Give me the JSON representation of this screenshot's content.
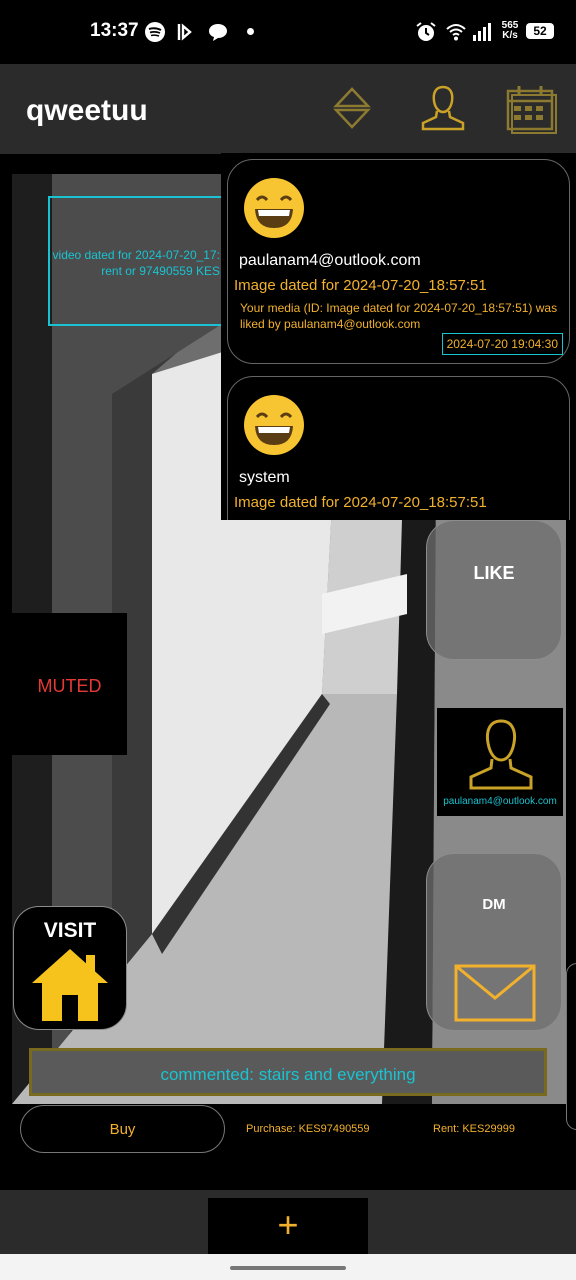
{
  "status_bar": {
    "time": "13:37",
    "network_speed_value": "565",
    "network_speed_unit": "K/s",
    "battery": "52",
    "icons": [
      "spotify-icon",
      "beeper-icon",
      "chat-icon",
      "dot-icon",
      "alarm-icon",
      "wifi-icon",
      "signal-icon",
      "battery-icon"
    ]
  },
  "app_bar": {
    "title": "qweetuu",
    "icons": [
      "sort-icon",
      "user-icon",
      "calendar-icon"
    ],
    "accent_color": "#C9A227"
  },
  "video": {
    "caption_line1": "video dated for 2024-07-20_17:",
    "caption_line2": "rent or 97490559 KES"
  },
  "notifications": [
    {
      "icon": "grinning-emoji-icon",
      "user": "paulanam4@outlook.com",
      "title": "Image dated for 2024-07-20_18:57:51",
      "message": "Your media (ID: Image dated for 2024-07-20_18:57:51) was liked by paulanam4@outlook.com",
      "time": "2024-07-20 19:04:30"
    },
    {
      "icon": "grinning-emoji-icon",
      "user": "system",
      "title": "Image dated for 2024-07-20_18:57:51",
      "message": "",
      "time": ""
    }
  ],
  "actions": {
    "like_label": "LIKE",
    "profile_email": "paulanam4@outlook.com",
    "dm_label": "DM",
    "muted_label": "MUTED",
    "visit_label": "VISIT",
    "comment": "commented: stairs and everything",
    "buy_label": "Buy",
    "purchase_price": "Purchase: KES97490559",
    "rent_price": "Rent: KES29999",
    "add_label": "+"
  },
  "colors": {
    "gold": "#F2B12D",
    "cyan": "#19C3D1",
    "muted_red": "#E53935"
  }
}
